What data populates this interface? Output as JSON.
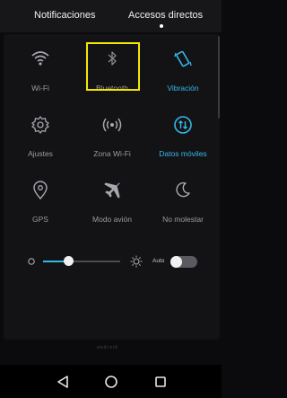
{
  "tabs": {
    "notifications": "Notificaciones",
    "shortcuts": "Accesos directos"
  },
  "tiles": [
    {
      "label": "Wi-Fi",
      "icon": "wifi-icon",
      "active": false
    },
    {
      "label": "Bluetooth",
      "icon": "bluetooth-icon",
      "active": false
    },
    {
      "label": "Vibración",
      "icon": "vibration-icon",
      "active": true
    },
    {
      "label": "Ajustes",
      "icon": "settings-icon",
      "active": false
    },
    {
      "label": "Zona Wi-Fi",
      "icon": "hotspot-icon",
      "active": false
    },
    {
      "label": "Datos móviles",
      "icon": "mobile-data-icon",
      "active": true
    },
    {
      "label": "GPS",
      "icon": "location-icon",
      "active": false
    },
    {
      "label": "Modo avión",
      "icon": "airplane-icon",
      "active": false
    },
    {
      "label": "No molestar",
      "icon": "moon-icon",
      "active": false
    }
  ],
  "brightness": {
    "level": 0.33,
    "auto_label": "Auto",
    "auto_enabled": false
  },
  "watermark": "android",
  "colors": {
    "accent": "#35b8e8",
    "highlight": "#f3e700",
    "background": "#0b0b0d"
  },
  "navbar": {
    "icons": [
      "back-icon",
      "home-icon",
      "recents-icon"
    ]
  }
}
